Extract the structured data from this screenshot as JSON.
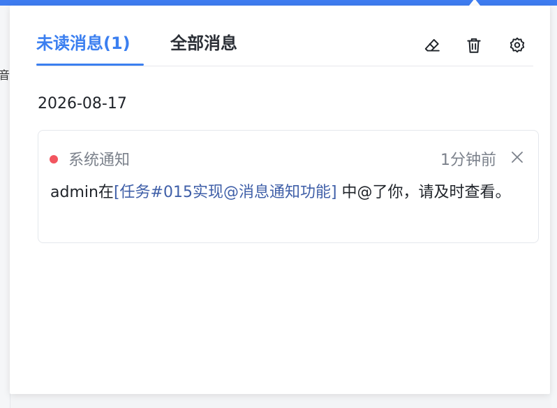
{
  "background": {
    "left_glyph": "音"
  },
  "panel": {
    "tabs": [
      {
        "label": "未读消息(1)",
        "active": true
      },
      {
        "label": "全部消息",
        "active": false
      }
    ],
    "toolbar": {
      "icons": [
        "eraser-icon",
        "trash-icon",
        "gear-icon"
      ]
    },
    "date_group": "2026-08-17",
    "notifications": [
      {
        "unread": true,
        "source": "系统通知",
        "time": "1分钟前",
        "body_prefix": "admin在",
        "link_text": "[任务#015实现@消息通知功能]",
        "body_suffix": " 中@了你，请及时查看。"
      }
    ]
  },
  "colors": {
    "accent": "#3b7ff0",
    "link": "#3f5fa8",
    "unread_dot": "#f2555f",
    "top_bar": "#3e7cf0"
  }
}
